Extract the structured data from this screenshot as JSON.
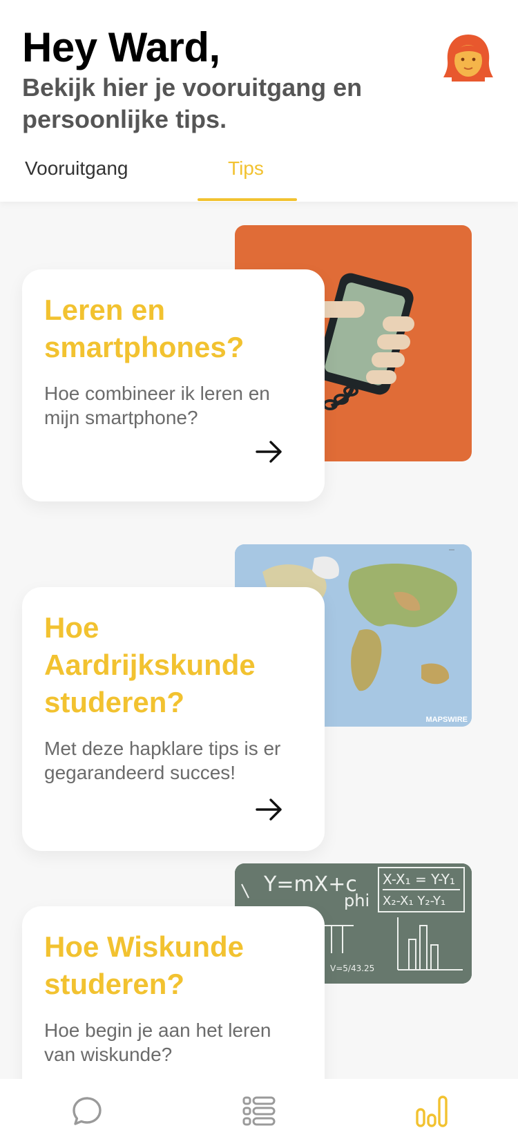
{
  "header": {
    "greeting": "Hey Ward,",
    "subtitle": "Bekijk hier je vooruitgang en persoonlijke tips.",
    "avatar_icon": "user-avatar-icon"
  },
  "tabs": [
    {
      "label": "Vooruitgang",
      "active": false
    },
    {
      "label": "Tips",
      "active": true
    }
  ],
  "tips": [
    {
      "title": "Leren en smartphones?",
      "description": "Hoe combineer ik leren en mijn smartphone?",
      "image": "hand-holding-chained-phone-illustration"
    },
    {
      "title": "Hoe Aardrijkskunde studeren?",
      "description": "Met deze hapklare tips is er gegarandeerd succes!",
      "image": "world-map-illustration",
      "image_caption": "MAPSWIRE"
    },
    {
      "title": "Hoe Wiskunde studeren?",
      "description": "Hoe begin je aan het leren van wiskunde?",
      "image": "chalkboard-math-illustration"
    }
  ],
  "chalkboard": {
    "eq1": "Y=mX+c",
    "eq2": "phi",
    "eq3": "X-X₁ = Y-Y₁",
    "eq4": "X₂-X₁   Y₂-Y₁",
    "eq5": "V=5/43.25"
  },
  "bottom_nav": {
    "items": [
      "chat-bubble-icon",
      "list-icon",
      "stats-bar-icon"
    ],
    "active": "stats-bar-icon"
  },
  "colors": {
    "accent": "#f2c230",
    "orange_bg": "#e06c37",
    "chalkboard_bg": "#67786d",
    "icon_gray": "#9a9a9a"
  }
}
